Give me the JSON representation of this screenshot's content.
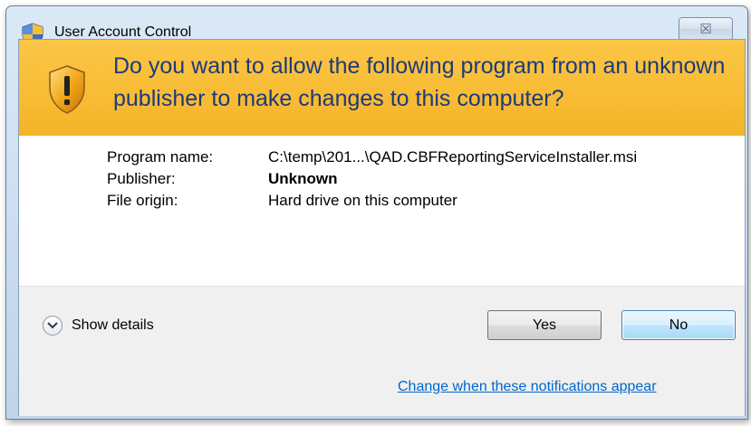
{
  "window": {
    "title": "User Account Control",
    "close_symbol": "☒"
  },
  "banner": {
    "question": "Do you want to allow the following program from an unknown publisher to make changes to this computer?",
    "icon": "warning-shield-icon",
    "color": "#f5b428",
    "text_color": "#1c3a7a"
  },
  "info": {
    "rows": [
      {
        "label": "Program name:",
        "value": "C:\\temp\\201...\\QAD.CBFReportingServiceInstaller.msi"
      },
      {
        "label": "Publisher:",
        "value": "Unknown"
      },
      {
        "label": "File origin:",
        "value": "Hard drive on this computer"
      }
    ]
  },
  "footer": {
    "show_details_label": "Show details",
    "yes_label": "Yes",
    "no_label": "No",
    "link_label": "Change when these notifications appear",
    "link_color": "#0066cc"
  }
}
